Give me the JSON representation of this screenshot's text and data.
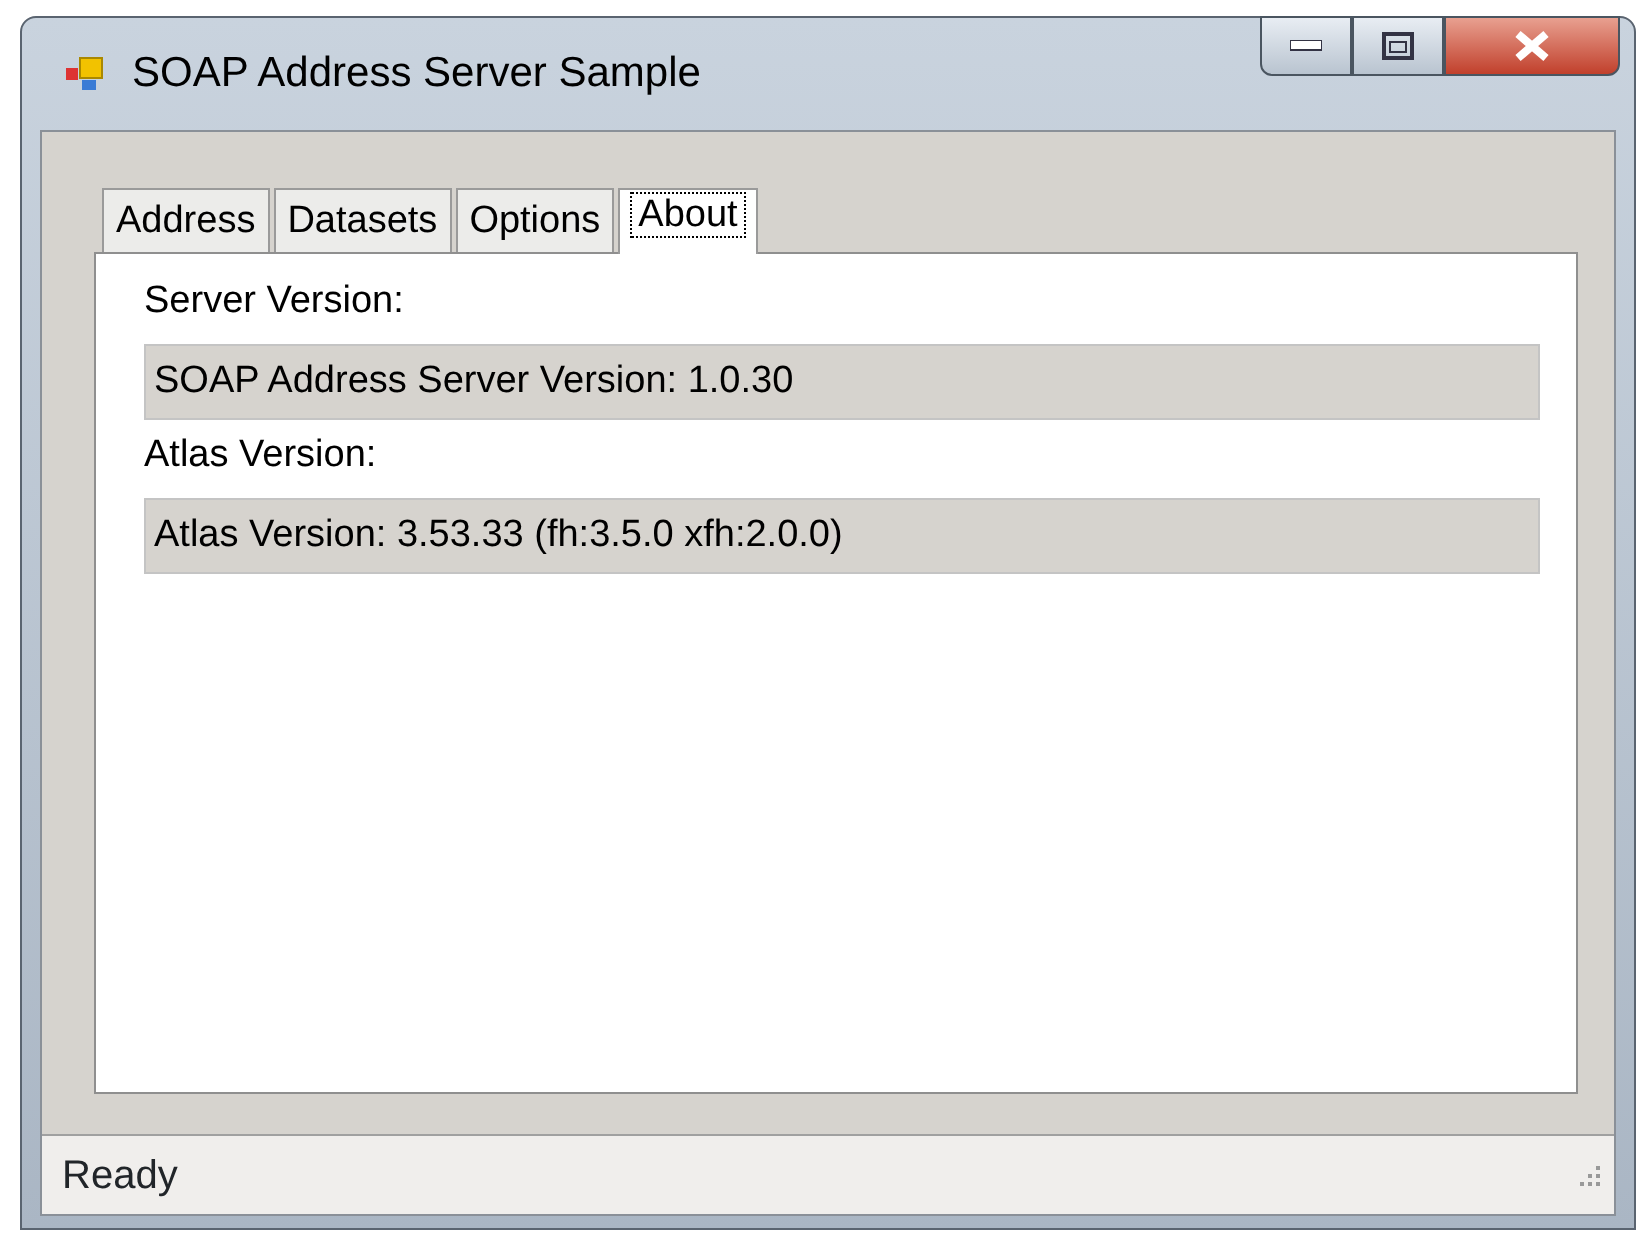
{
  "window": {
    "title": "SOAP Address Server Sample"
  },
  "tabs": [
    {
      "label": "Address",
      "selected": false
    },
    {
      "label": "Datasets",
      "selected": false
    },
    {
      "label": "Options",
      "selected": false
    },
    {
      "label": "About",
      "selected": true
    }
  ],
  "fields": [
    {
      "label": "Server Version:",
      "value": "SOAP Address Server Version: 1.0.30"
    },
    {
      "label": "Atlas Version:",
      "value": "Atlas Version: 3.53.33 (fh:3.5.0 xfh:2.0.0)"
    }
  ],
  "status_bar": {
    "text": "Ready"
  }
}
